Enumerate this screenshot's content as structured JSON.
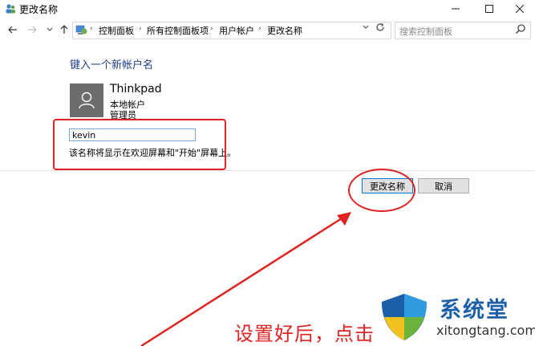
{
  "window": {
    "title": "更改名称"
  },
  "address": {
    "crumbs": [
      "控制面板",
      "所有控制面板项",
      "用户帐户",
      "更改名称"
    ]
  },
  "search": {
    "placeholder": "搜索控制面板"
  },
  "content": {
    "heading": "键入一个新帐户名",
    "account_name": "Thinkpad",
    "account_type": "本地帐户",
    "account_role": "管理员",
    "new_name_value": "kevin",
    "hint": "该名称将显示在欢迎屏幕和\"开始\"屏幕上。"
  },
  "buttons": {
    "rename": "更改名称",
    "cancel": "取消"
  },
  "annotation": {
    "text": "设置好后，点击"
  },
  "watermark": {
    "brand": "系统堂",
    "site": "xitongtang.com"
  },
  "colors": {
    "accent": "#1e3d8f",
    "annotation_red": "#e02424",
    "input_focus": "#7aa7d6"
  }
}
